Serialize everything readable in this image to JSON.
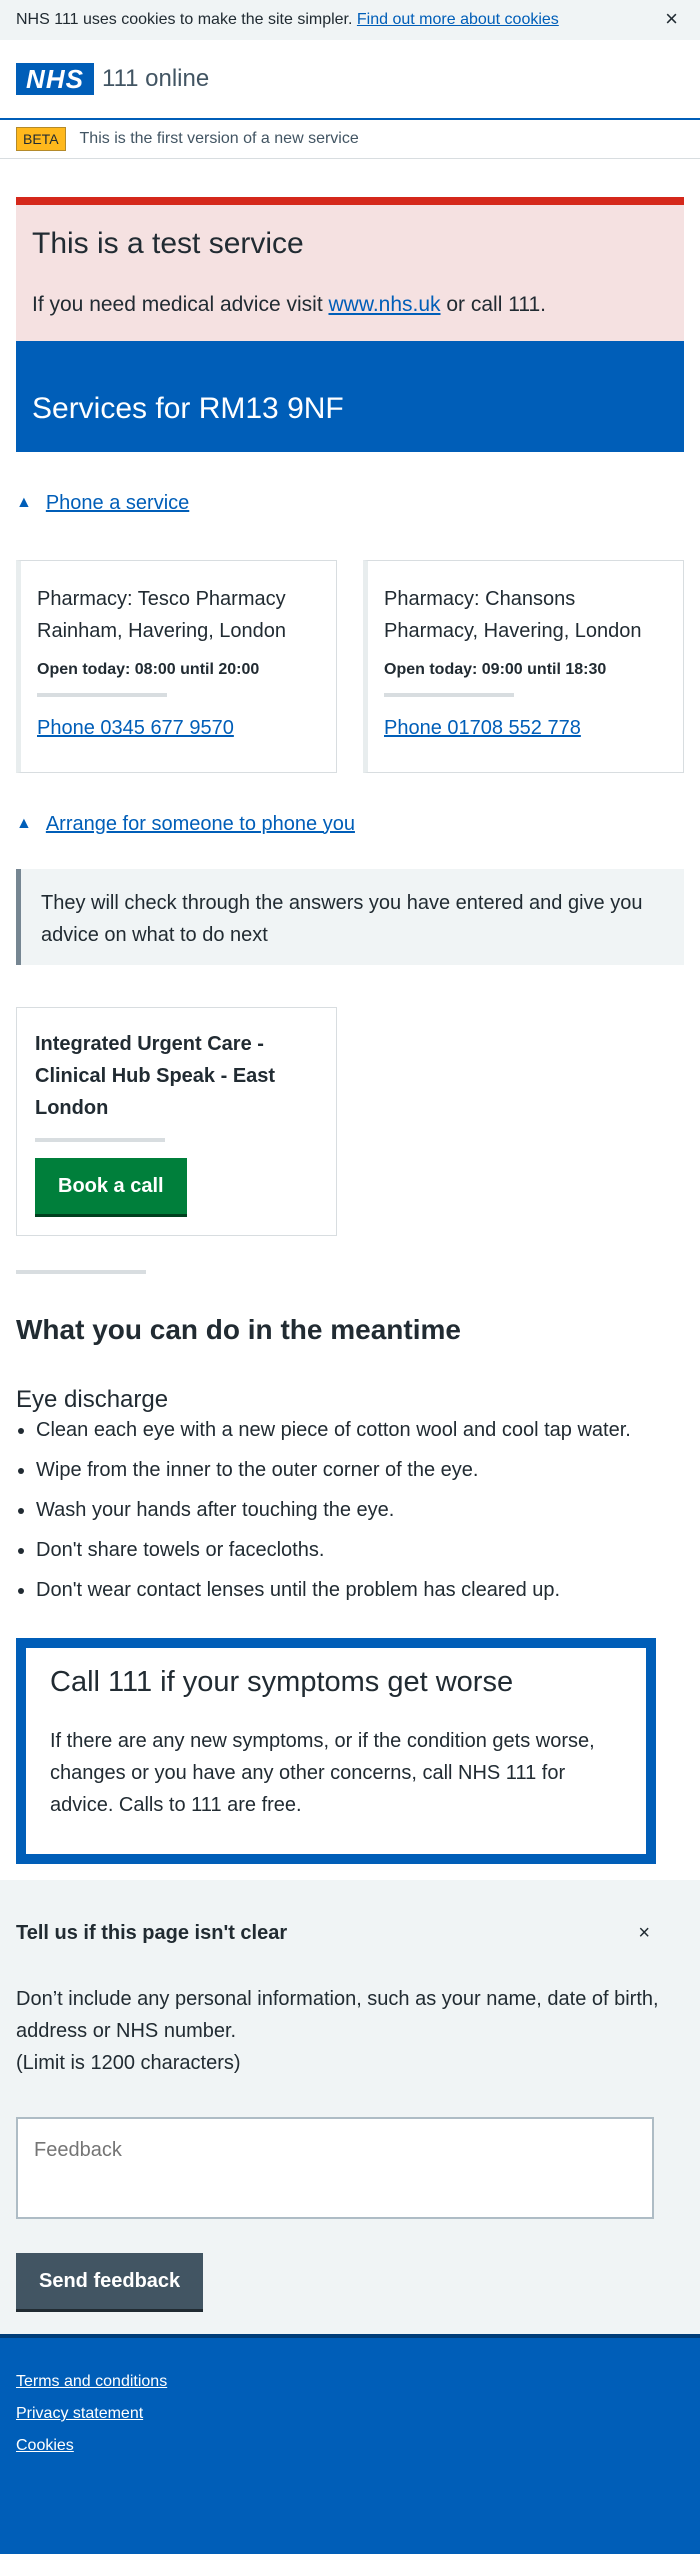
{
  "cookie": {
    "text": "NHS 111 uses cookies to make the site simpler.",
    "link": "Find out more about cookies",
    "close": "×"
  },
  "header": {
    "logo": "NHS",
    "service": "111 online"
  },
  "beta": {
    "tag": "BETA",
    "text": "This is the first version of a new service"
  },
  "test": {
    "title": "This is a test service",
    "pre": "If you need medical advice visit ",
    "link": "www.nhs.uk",
    "post": " or call 111."
  },
  "services": {
    "title": "Services for RM13 9NF"
  },
  "phone_section": {
    "icon": "triangle-up-icon",
    "label": "Phone a service"
  },
  "pharmacies": [
    {
      "name": "Pharmacy: Tesco Pharmacy Rainham, Havering, London",
      "open": "Open today: 08:00 until 20:00",
      "phone": "Phone 0345 677 9570"
    },
    {
      "name": "Pharmacy: Chansons Pharmacy, Havering, London",
      "open": "Open today: 09:00 until 18:30",
      "phone": "Phone 01708 552 778"
    }
  ],
  "arrange_section": {
    "label": "Arrange for someone to phone you"
  },
  "inset": {
    "text": "They will check through the answers you have entered and give you advice on what to do next"
  },
  "callback": {
    "name": "Integrated Urgent Care - Clinical Hub Speak - East London",
    "button": "Book a call"
  },
  "meantime": {
    "title": "What you can do in the meantime",
    "subtitle": "Eye discharge",
    "items": [
      "Clean each eye with a new piece of cotton wool and cool tap water.",
      "Wipe from the inner to the outer corner of the eye.",
      "Wash your hands after touching the eye.",
      "Don't share towels or facecloths.",
      "Don't wear contact lenses until the problem has cleared up."
    ]
  },
  "care": {
    "title": "Call 111 if your symptoms get worse",
    "text": "If there are any new symptoms, or if the condition gets worse, changes or you have any other concerns, call NHS 111 for advice. Calls to 111 are free."
  },
  "feedback": {
    "title": "Tell us if this page isn't clear",
    "close": "×",
    "info1": "Don’t include any personal information, such as your name, date of birth, address or NHS number.",
    "info2": "(Limit is 1200 characters)",
    "placeholder": "Feedback",
    "button": "Send feedback"
  },
  "footer": {
    "links": [
      "Terms and conditions",
      "Privacy statement",
      "Cookies"
    ]
  },
  "colors": {
    "nhs_blue": "#005eb8",
    "green": "#007f3b",
    "red": "#d5281b",
    "yellow": "#ffb81c"
  }
}
